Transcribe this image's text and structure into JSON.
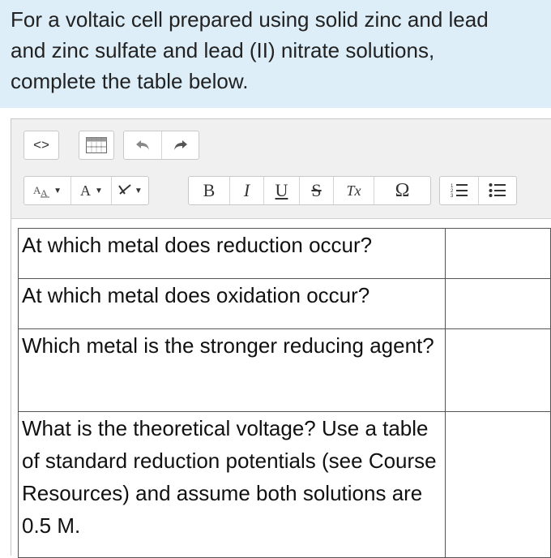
{
  "question": {
    "lines": [
      "For a voltaic cell prepared using solid zinc and lead",
      "and zinc sulfate and lead (II) nitrate solutions,",
      "complete the table below."
    ]
  },
  "toolbar": {
    "source_label": "<>",
    "arrow_down": "▼",
    "bold": "B",
    "italic": "I",
    "underline": "U",
    "strike": "S",
    "clear_format": "Tx",
    "omega": "Ω"
  },
  "table": {
    "rows": [
      {
        "question": "At which metal does reduction occur?",
        "answer": ""
      },
      {
        "question": "At which metal does oxidation occur?",
        "answer": ""
      },
      {
        "question": "Which metal is the stronger reducing agent?",
        "answer": ""
      },
      {
        "question": "What is the theoretical voltage? Use a table of standard reduction potentials (see Course Resources) and assume both solutions are 0.5 M.",
        "answer": ""
      }
    ]
  }
}
